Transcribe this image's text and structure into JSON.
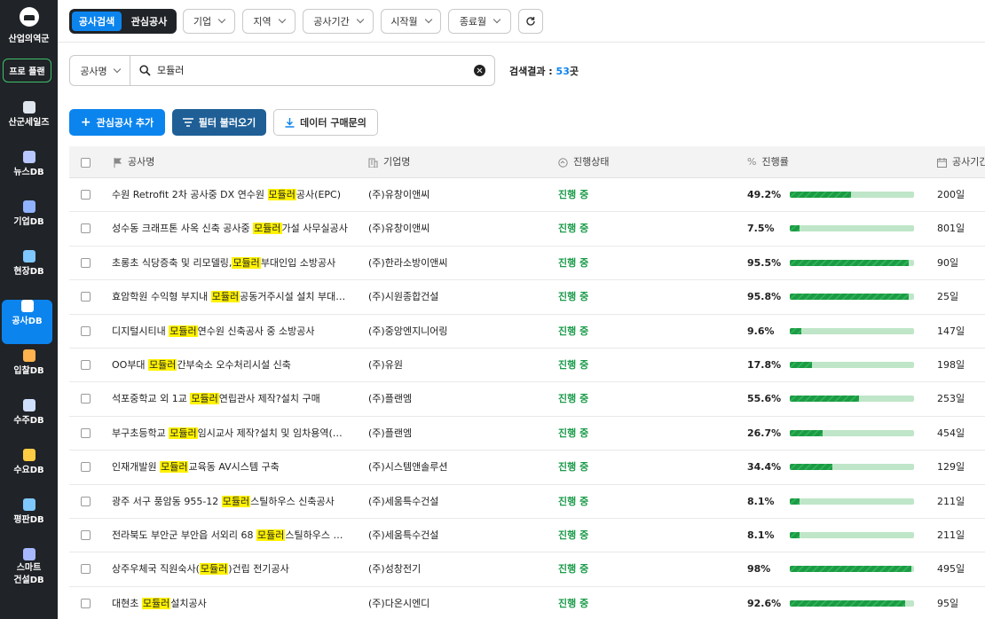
{
  "sidebar": {
    "brand_label": "산업의역군",
    "pro_label": "프로 플랜",
    "items": [
      {
        "label": "산군세일즈",
        "icon": "helmet-icon",
        "active": false
      },
      {
        "label": "뉴스DB",
        "icon": "news-icon",
        "active": false
      },
      {
        "label": "기업DB",
        "icon": "building-icon",
        "active": false
      },
      {
        "label": "현장DB",
        "icon": "site-pin-icon",
        "active": false
      },
      {
        "label": "공사DB",
        "icon": "construction-icon",
        "active": true
      },
      {
        "label": "입찰DB",
        "icon": "gavel-icon",
        "active": false
      },
      {
        "label": "수주DB",
        "icon": "document-icon",
        "active": false
      },
      {
        "label": "수요DB",
        "icon": "bar-chart-icon",
        "active": false
      },
      {
        "label": "평판DB",
        "icon": "reputation-icon",
        "active": false
      },
      {
        "label": "스마트\n건설DB",
        "label_lines": [
          "스마트",
          "건설DB"
        ],
        "icon": "smart-build-icon",
        "active": false
      }
    ]
  },
  "toolbar": {
    "segments": [
      "공사검색",
      "관심공사"
    ],
    "filters": [
      "기업",
      "지역",
      "공사기간",
      "시작월",
      "종료월"
    ],
    "refresh_icon": "refresh-icon"
  },
  "search": {
    "field": "공사명",
    "query": "모듈러",
    "result_label": "검색결과 : ",
    "result_count": "53",
    "result_unit": "곳"
  },
  "actions": {
    "add": "관심공사 추가",
    "load_filter": "필터 불러오기",
    "buy_data": "데이터 구매문의"
  },
  "table": {
    "columns": [
      "공사명",
      "기업명",
      "진행상태",
      "진행률",
      "공사기간"
    ],
    "rows": [
      {
        "pre": "수원 Retrofit 2차 공사중 DX 연수원 ",
        "hl": "모듈러",
        "post": "공사(EPC)",
        "company": "(주)유창이앤씨",
        "status": "진행 중",
        "pct_label": "49.2%",
        "pct": 49.2,
        "duration": "200일"
      },
      {
        "pre": "성수동 크래프톤 사옥 신축 공사중 ",
        "hl": "모듈러",
        "post": "가설 사무실공사",
        "company": "(주)유창이앤씨",
        "status": "진행 중",
        "pct_label": "7.5%",
        "pct": 7.5,
        "duration": "801일"
      },
      {
        "pre": "초롱초 식당증축 및 리모델링,",
        "hl": "모듈러",
        "post": "부대인입 소방공사",
        "company": "(주)한라소방이앤씨",
        "status": "진행 중",
        "pct_label": "95.5%",
        "pct": 95.5,
        "duration": "90일"
      },
      {
        "pre": "효암학원 수익형 부지내 ",
        "hl": "모듈러",
        "post": "공동거주시설 설치 부대…",
        "company": "(주)시원종합건설",
        "status": "진행 중",
        "pct_label": "95.8%",
        "pct": 95.8,
        "duration": "25일"
      },
      {
        "pre": "디지털시티내 ",
        "hl": "모듈러",
        "post": "연수원 신축공사 중 소방공사",
        "company": "(주)중앙엔지니어링",
        "status": "진행 중",
        "pct_label": "9.6%",
        "pct": 9.6,
        "duration": "147일"
      },
      {
        "pre": "OO부대 ",
        "hl": "모듈러",
        "post": "간부숙소 오수처리시설 신축",
        "company": "(주)유원",
        "status": "진행 중",
        "pct_label": "17.8%",
        "pct": 17.8,
        "duration": "198일"
      },
      {
        "pre": "석포중학교 외 1교 ",
        "hl": "모듈러",
        "post": "연립관사 제작?설치 구매",
        "company": "(주)플랜엠",
        "status": "진행 중",
        "pct_label": "55.6%",
        "pct": 55.6,
        "duration": "253일"
      },
      {
        "pre": "부구초등학교 ",
        "hl": "모듈러",
        "post": "임시교사 제작?설치 및 임차용역(…",
        "company": "(주)플랜엠",
        "status": "진행 중",
        "pct_label": "26.7%",
        "pct": 26.7,
        "duration": "454일"
      },
      {
        "pre": "인재개발원 ",
        "hl": "모듈러",
        "post": "교육동 AV시스템 구축",
        "company": "(주)시스템앤솔루션",
        "status": "진행 중",
        "pct_label": "34.4%",
        "pct": 34.4,
        "duration": "129일"
      },
      {
        "pre": "광주 서구 풍암동 955-12 ",
        "hl": "모듈러",
        "post": "스틸하우스 신축공사",
        "company": "(주)세움특수건설",
        "status": "진행 중",
        "pct_label": "8.1%",
        "pct": 8.1,
        "duration": "211일"
      },
      {
        "pre": "전라북도 부안군 부안읍 서외리 68 ",
        "hl": "모듈러",
        "post": "스틸하우스 …",
        "company": "(주)세움특수건설",
        "status": "진행 중",
        "pct_label": "8.1%",
        "pct": 8.1,
        "duration": "211일"
      },
      {
        "pre": "상주우체국 직원숙사(",
        "hl": "모듈러",
        "post": ")건립 전기공사",
        "company": "(주)성창전기",
        "status": "진행 중",
        "pct_label": "98%",
        "pct": 98,
        "duration": "495일"
      },
      {
        "pre": "대현초 ",
        "hl": "모듈러",
        "post": "설치공사",
        "company": "(주)다온시엔디",
        "status": "진행 중",
        "pct_label": "92.6%",
        "pct": 92.6,
        "duration": "95일"
      }
    ]
  },
  "colors": {
    "accent": "#0b84ee",
    "sidebar_bg": "#202327",
    "status_green": "#1b9b4a",
    "highlight": "#fff200"
  }
}
